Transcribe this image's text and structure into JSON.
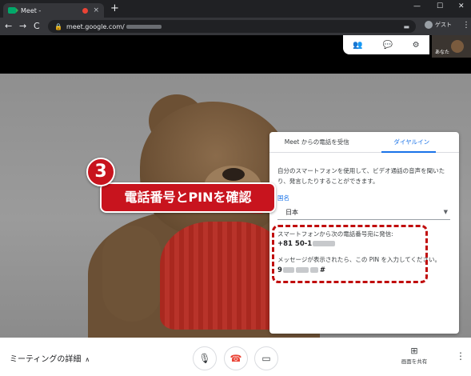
{
  "browser": {
    "tab_title": "Meet - ",
    "tab_close": "×",
    "new_tab": "+",
    "win_min": "—",
    "win_max": "☐",
    "win_close": "✕",
    "back": "←",
    "forward": "→",
    "reload": "C",
    "url": "meet.google.com/",
    "guest_label": "ゲスト",
    "menu": "⋮"
  },
  "meet_top": {
    "people_icon": "people-icon",
    "chat_icon": "chat-icon",
    "activities_icon": "activities-icon",
    "self_label": "あなた"
  },
  "panel": {
    "tabs": [
      "Meet からの電話を受信",
      "ダイヤルイン"
    ],
    "active_tab": 1,
    "description": "自分のスマートフォンを使用して、ビデオ通話の音声を聞いたり、発言したりすることができます。",
    "country_label": "国名",
    "country_value": "日本",
    "dial_instruction": "スマートフォンから次の電話番号宛に発信:",
    "phone_prefix": "+81 50-1",
    "pin_instruction": "メッセージが表示されたら、この PIN を入力してください。",
    "pin_prefix": "9",
    "pin_suffix": "#"
  },
  "annotation": {
    "step_number": "3",
    "callout_text": "電話番号とPINを確認",
    "highlight_color": "#c8141e"
  },
  "bottom": {
    "meeting_details": "ミーティングの詳細",
    "mic_icon": "mic-icon",
    "hangup_icon": "hangup-icon",
    "camera_icon": "camera-icon",
    "share_label": "画面を共有",
    "more_icon": "more-vert-icon"
  }
}
